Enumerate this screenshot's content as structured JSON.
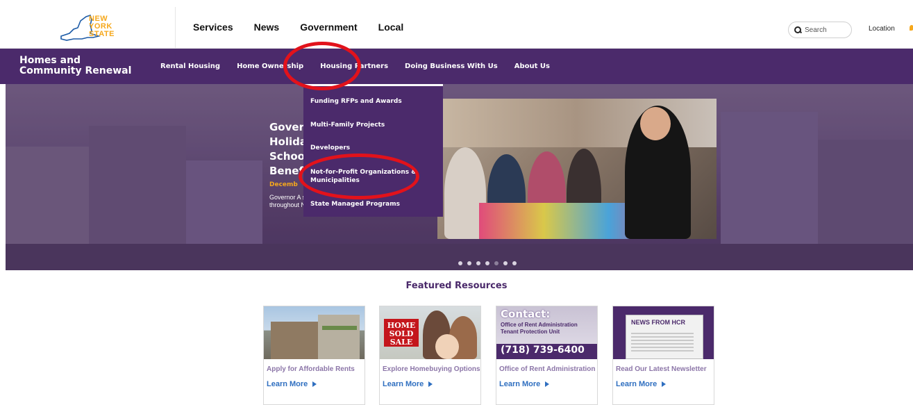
{
  "header": {
    "logo_lines": [
      "NEW",
      "YORK",
      "STATE"
    ],
    "nav": [
      "Services",
      "News",
      "Government",
      "Local"
    ],
    "search_placeholder": "Search",
    "location_label": "Location"
  },
  "agency": {
    "title": "Homes and Community Renewal",
    "nav": [
      "Rental Housing",
      "Home Ownership",
      "Housing Partners",
      "Doing Business With Us",
      "About Us"
    ],
    "active_nav": "Housing Partners"
  },
  "dropdown": {
    "items": [
      "Funding RFPs and Awards",
      "Multi-Family Projects",
      "Developers",
      "Not-for-Profit Organizations & Municipalities",
      "State Managed Programs"
    ]
  },
  "hero": {
    "headline_lines": [
      "Gover",
      "Holida",
      "Schoo",
      "Benef"
    ],
    "date": "Decemb",
    "body": "Governor A statewide holiday drive to benefit families in need throughout New York.",
    "dots": [
      false,
      false,
      false,
      false,
      true,
      false,
      false
    ]
  },
  "featured": {
    "title": "Featured Resources",
    "cards": [
      {
        "title": "Apply for Affordable Rents",
        "link": "Learn More"
      },
      {
        "title": "Explore Homebuying Options",
        "link": "Learn More",
        "image_text": "HOME SOLD SALE"
      },
      {
        "title": "Office of Rent Administration",
        "link": "Learn More",
        "image_text": {
          "heading": "Contact:",
          "line1": "Office of Rent Administration",
          "line2": "Tenant Protection Unit",
          "phone": "(718) 739-6400"
        }
      },
      {
        "title": "Read Our Latest Newsletter",
        "link": "Learn More",
        "image_text": "NEWS FROM HCR"
      }
    ]
  },
  "colors": {
    "brand_purple": "#4b2a6b",
    "accent_gold": "#f6a81c",
    "link_blue": "#2f6fc0",
    "annotation_red": "#e2121b"
  }
}
